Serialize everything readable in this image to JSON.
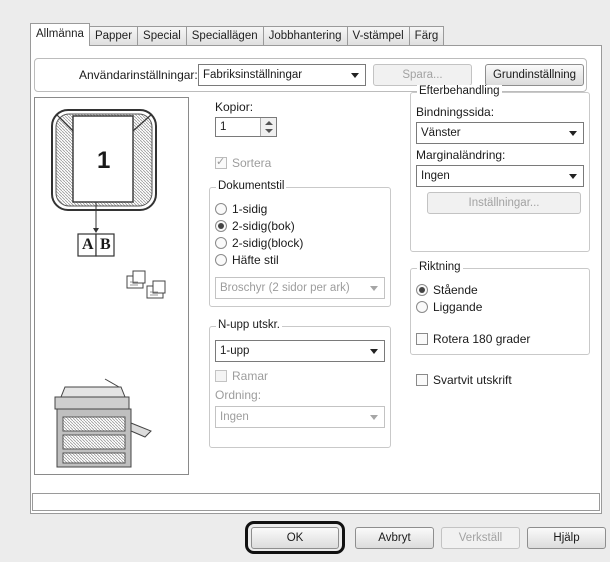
{
  "tabs": [
    "Allmänna",
    "Papper",
    "Special",
    "Speciallägen",
    "Jobbhantering",
    "V-stämpel",
    "Färg"
  ],
  "user_settings": {
    "label": "Användarinställningar:",
    "value": "Fabriksinställningar",
    "save_label": "Spara...",
    "default_label": "Grundinställning"
  },
  "preview": {
    "page_number": "1",
    "label_a": "A",
    "label_b": "B"
  },
  "copies": {
    "label": "Kopior:",
    "value": "1",
    "collate_label": "Sortera",
    "collate_checked": true
  },
  "document_style": {
    "title": "Dokumentstil",
    "options": [
      "1-sidig",
      "2-sidig(bok)",
      "2-sidig(block)",
      "Häfte stil"
    ],
    "selected": "2-sidig(bok)",
    "booklet_value": "Broschyr (2 sidor per ark)"
  },
  "nup": {
    "title": "N-upp utskr.",
    "value": "1-upp",
    "borders_label": "Ramar",
    "order_label": "Ordning:",
    "order_value": "Ingen"
  },
  "finishing": {
    "title": "Efterbehandling",
    "binding_label": "Bindningssida:",
    "binding_value": "Vänster",
    "margin_label": "Marginaländring:",
    "margin_value": "Ingen",
    "settings_label": "Inställningar..."
  },
  "orientation": {
    "title": "Riktning",
    "options": [
      "Stående",
      "Liggande"
    ],
    "selected": "Stående",
    "rotate_label": "Rotera 180 grader"
  },
  "bw_print_label": "Svartvit utskrift",
  "buttons": {
    "ok": "OK",
    "cancel": "Avbryt",
    "apply": "Verkställ",
    "help": "Hjälp"
  },
  "colors": {
    "highlight": "#1a1a1a",
    "panel": "#ffffff",
    "dialog": "#ececec"
  }
}
